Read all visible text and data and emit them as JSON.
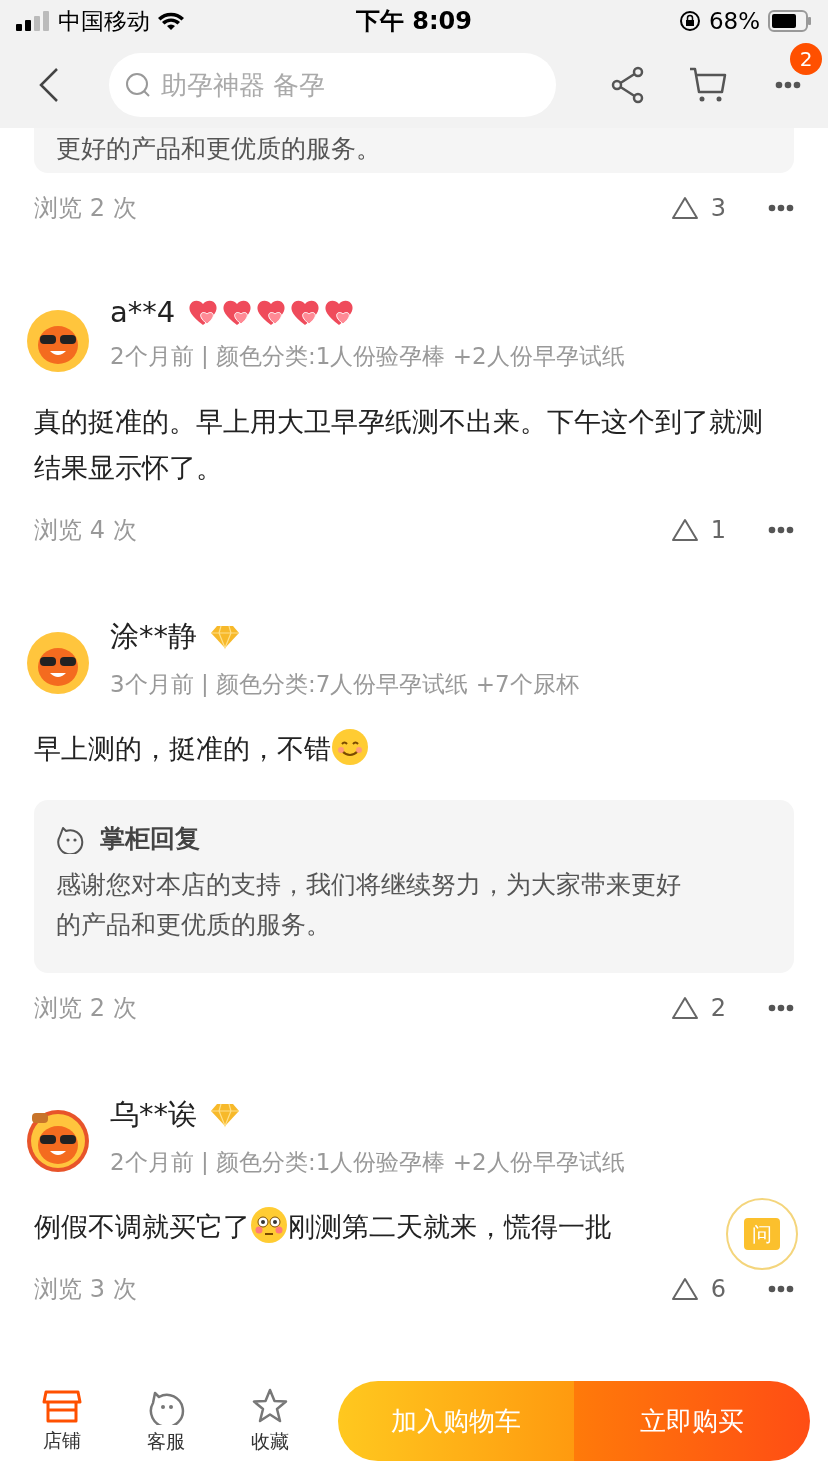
{
  "status_bar": {
    "carrier": "中国移动",
    "time": "下午 8:09",
    "battery": "68%"
  },
  "nav": {
    "search_placeholder": "助孕神器 备孕",
    "more_badge": "2"
  },
  "top_fragment": {
    "reply_text": "更好的产品和更优质的服务。",
    "views": "浏览 2 次",
    "likes": "3"
  },
  "reviews": [
    {
      "avatar": {
        "kind": "plain"
      },
      "user": "a**4",
      "badge_icons": [
        {
          "kind": "heart"
        },
        {
          "kind": "heart"
        },
        {
          "kind": "heart"
        },
        {
          "kind": "heart"
        },
        {
          "kind": "heart"
        }
      ],
      "meta": "2个月前 | 颜色分类:1人份验孕棒 +2人份早孕试纸",
      "content": [
        {
          "kind": "text",
          "text": "真的挺准的。早上用大卫早孕纸测不出来。下午这个到了就测结果显示怀了。"
        }
      ],
      "views": "浏览 4 次",
      "likes": "1"
    },
    {
      "avatar": {
        "kind": "plain"
      },
      "user": "涂**静",
      "badge_icons": [
        {
          "kind": "diamond"
        }
      ],
      "meta": "3个月前 | 颜色分类:7人份早孕试纸 +7个尿杯",
      "content": [
        {
          "kind": "text",
          "text": "早上测的，挺准的，不错"
        },
        {
          "kind": "smile"
        }
      ],
      "reply": {
        "title": "掌柜回复",
        "text": "感谢您对本店的支持，我们将继续努力，为大家带来更好的产品和更优质的服务。"
      },
      "views": "浏览 2 次",
      "likes": "2"
    },
    {
      "avatar": {
        "kind": "decorated"
      },
      "user": "乌**诶",
      "badge_icons": [
        {
          "kind": "diamond"
        }
      ],
      "meta": "2个月前 | 颜色分类:1人份验孕棒 +2人份早孕试纸",
      "content": [
        {
          "kind": "text",
          "text": "例假不调就买它了"
        },
        {
          "kind": "flushed"
        },
        {
          "kind": "text",
          "text": "刚测第二天就来，慌得一批"
        }
      ],
      "views": "浏览 3 次",
      "likes": "6"
    }
  ],
  "ask_button": "问",
  "bottom_bar": {
    "tabs": [
      {
        "kind": "shop",
        "label": "店铺",
        "selected": true
      },
      {
        "kind": "service",
        "label": "客服",
        "selected": false
      },
      {
        "kind": "favorite",
        "label": "收藏",
        "selected": false
      }
    ],
    "add_to_cart": "加入购物车",
    "buy_now": "立即购买"
  }
}
